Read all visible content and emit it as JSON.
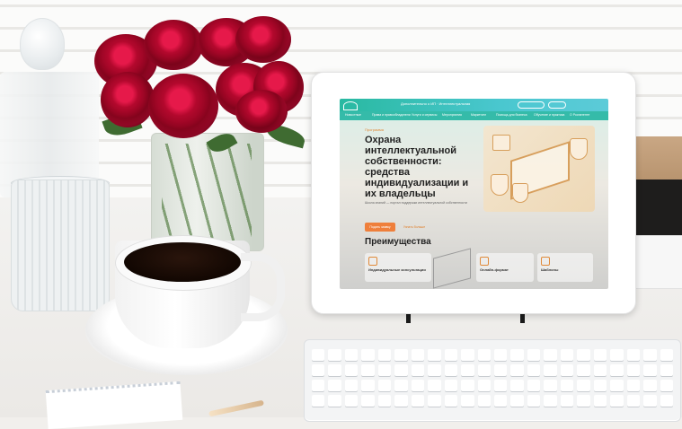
{
  "scene": {
    "description_items": [
      "vase-with-roses",
      "coffee-cup",
      "glass",
      "tablet",
      "keyboard"
    ],
    "colors": {
      "wall": "#fbfbfa",
      "rose": "#b3082d",
      "coffee": "#1a0b04",
      "accent_teal": "#29b9a1",
      "accent_orange": "#ef7f3b"
    }
  },
  "tablet_screen": {
    "header": {
      "top_link": "Дополнительно о ИП · Интеллектуальная"
    },
    "nav": [
      "Новостные",
      "Права и правообладатели",
      "Услуги и сервисы",
      "Мероприятия",
      "Маркетинг",
      "Помощь для бизнеса",
      "Обучение и практика",
      "О Роспатенте"
    ],
    "tag": "Программа",
    "title": "Охрана интеллектуальной собственности: средства индивидуализации и их владельцы",
    "subtitle": "Школа знаний — портал поддержки интеллектуальной собственности",
    "button_primary": "Подать заявку",
    "button_secondary": "Узнать больше",
    "section_title": "Преимущества",
    "cards": [
      {
        "title": "Индивидуальные консультации"
      },
      {
        "title": "Онлайн-формат"
      },
      {
        "title": "Шаблоны"
      }
    ]
  }
}
